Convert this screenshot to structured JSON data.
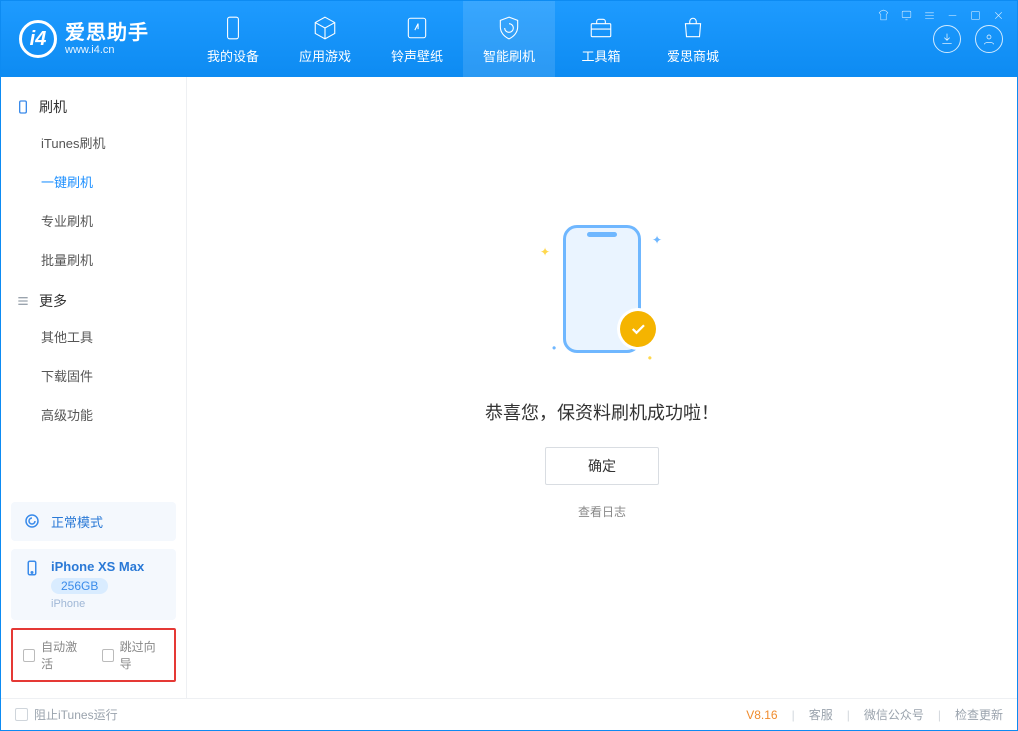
{
  "colors": {
    "accent": "#0d8bf2",
    "warn": "#f5b400",
    "highlight": "#e53935"
  },
  "logo": {
    "title": "爱思助手",
    "subtitle": "www.i4.cn",
    "glyph": "i4"
  },
  "nav": [
    {
      "label": "我的设备"
    },
    {
      "label": "应用游戏"
    },
    {
      "label": "铃声壁纸"
    },
    {
      "label": "智能刷机"
    },
    {
      "label": "工具箱"
    },
    {
      "label": "爱思商城"
    }
  ],
  "sidebar": {
    "groups": [
      {
        "title": "刷机",
        "items": [
          "iTunes刷机",
          "一键刷机",
          "专业刷机",
          "批量刷机"
        ],
        "active_index": 1
      },
      {
        "title": "更多",
        "items": [
          "其他工具",
          "下载固件",
          "高级功能"
        ]
      }
    ],
    "mode": "正常模式",
    "device": {
      "name": "iPhone XS Max",
      "capacity": "256GB",
      "type": "iPhone"
    },
    "options": {
      "auto_activate": "自动激活",
      "skip_guide": "跳过向导"
    }
  },
  "main": {
    "success": "恭喜您，保资料刷机成功啦！",
    "ok": "确定",
    "view_log": "查看日志"
  },
  "footer": {
    "block_itunes": "阻止iTunes运行",
    "version": "V8.16",
    "links": [
      "客服",
      "微信公众号",
      "检查更新"
    ]
  }
}
